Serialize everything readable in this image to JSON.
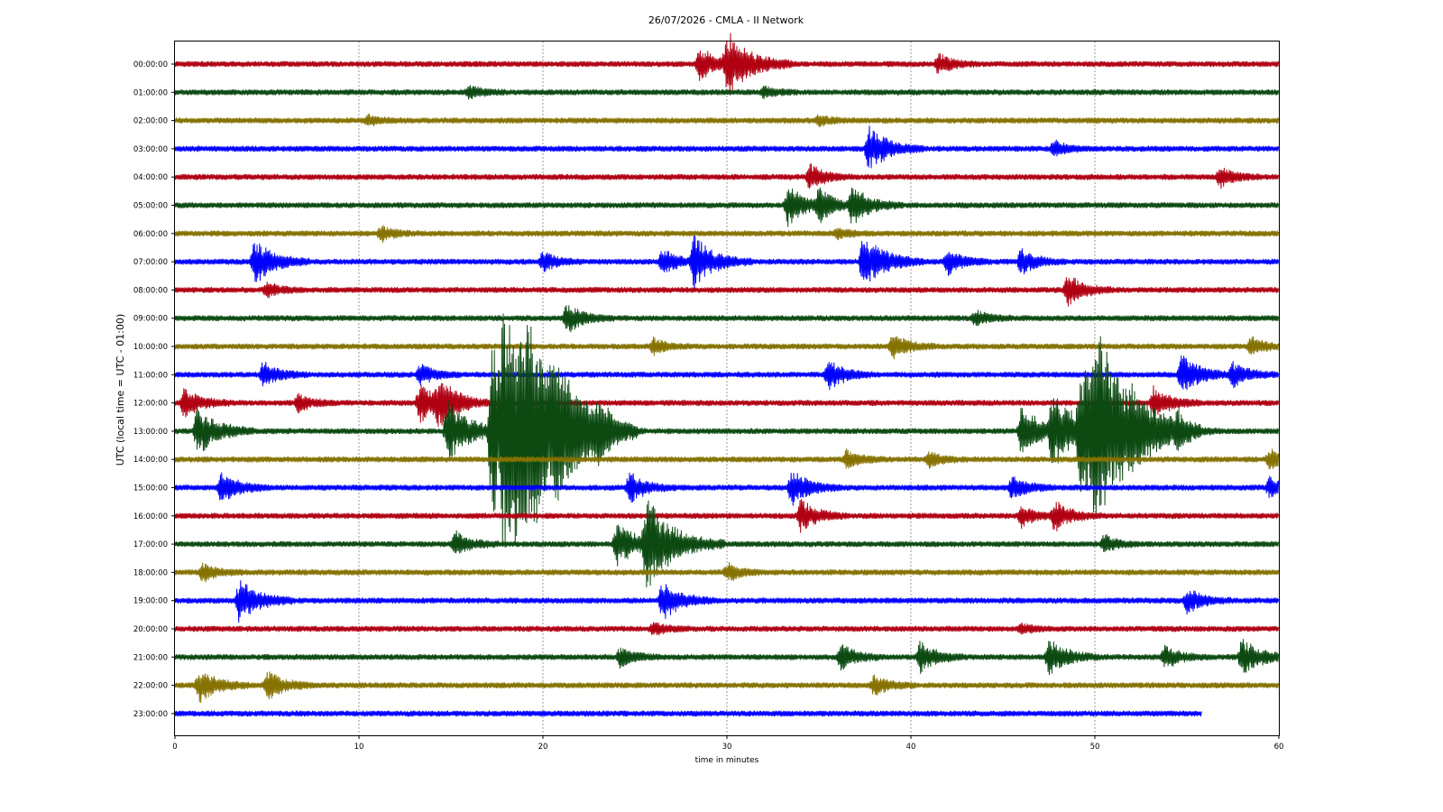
{
  "chart_data": {
    "type": "line",
    "title": "26/07/2026 - CMLA - II Network",
    "xlabel": "time in minutes",
    "ylabel": "UTC (local time = UTC - 01:00)",
    "xlim": [
      0,
      60
    ],
    "xticks": [
      "0",
      "10",
      "20",
      "30",
      "40",
      "50",
      "60"
    ],
    "grid": "vertical dashed lines at each 10 minutes",
    "trace_colors": [
      "#b00012",
      "#0c4a12",
      "#857200",
      "#0000ff"
    ],
    "rows": [
      {
        "label": "00:00:00",
        "end_min": 60,
        "events": [
          {
            "t": 28.5,
            "amp": 1.4
          },
          {
            "t": 30.0,
            "amp": 2.6
          },
          {
            "t": 41.5,
            "amp": 0.8
          }
        ]
      },
      {
        "label": "01:00:00",
        "end_min": 60,
        "events": [
          {
            "t": 16.0,
            "amp": 0.5
          },
          {
            "t": 32.0,
            "amp": 0.4
          }
        ]
      },
      {
        "label": "02:00:00",
        "end_min": 60,
        "events": [
          {
            "t": 10.5,
            "amp": 0.4
          },
          {
            "t": 35.0,
            "amp": 0.4
          }
        ]
      },
      {
        "label": "03:00:00",
        "end_min": 60,
        "events": [
          {
            "t": 37.7,
            "amp": 1.8
          },
          {
            "t": 47.8,
            "amp": 0.6
          }
        ]
      },
      {
        "label": "04:00:00",
        "end_min": 60,
        "events": [
          {
            "t": 34.5,
            "amp": 1.0
          },
          {
            "t": 56.8,
            "amp": 0.8
          }
        ]
      },
      {
        "label": "05:00:00",
        "end_min": 60,
        "events": [
          {
            "t": 33.3,
            "amp": 1.6
          },
          {
            "t": 35.0,
            "amp": 1.2
          },
          {
            "t": 36.8,
            "amp": 1.5
          }
        ]
      },
      {
        "label": "06:00:00",
        "end_min": 60,
        "events": [
          {
            "t": 11.2,
            "amp": 0.6
          },
          {
            "t": 36.0,
            "amp": 0.4
          }
        ]
      },
      {
        "label": "07:00:00",
        "end_min": 60,
        "events": [
          {
            "t": 4.3,
            "amp": 1.8
          },
          {
            "t": 20.0,
            "amp": 0.8
          },
          {
            "t": 26.5,
            "amp": 1.0
          },
          {
            "t": 28.2,
            "amp": 2.0
          },
          {
            "t": 37.4,
            "amp": 2.2
          },
          {
            "t": 42.0,
            "amp": 1.0
          },
          {
            "t": 46.0,
            "amp": 1.0
          }
        ]
      },
      {
        "label": "08:00:00",
        "end_min": 60,
        "events": [
          {
            "t": 5.0,
            "amp": 0.6
          },
          {
            "t": 48.5,
            "amp": 1.2
          }
        ]
      },
      {
        "label": "09:00:00",
        "end_min": 60,
        "events": [
          {
            "t": 21.3,
            "amp": 1.2
          },
          {
            "t": 43.5,
            "amp": 0.6
          }
        ]
      },
      {
        "label": "10:00:00",
        "end_min": 60,
        "events": [
          {
            "t": 26.0,
            "amp": 0.6
          },
          {
            "t": 39.0,
            "amp": 1.0
          },
          {
            "t": 58.5,
            "amp": 0.7
          }
        ]
      },
      {
        "label": "11:00:00",
        "end_min": 60,
        "events": [
          {
            "t": 4.8,
            "amp": 1.0
          },
          {
            "t": 13.3,
            "amp": 0.8
          },
          {
            "t": 35.5,
            "amp": 1.2
          },
          {
            "t": 54.7,
            "amp": 1.6
          },
          {
            "t": 57.5,
            "amp": 1.0
          }
        ]
      },
      {
        "label": "12:00:00",
        "end_min": 60,
        "events": [
          {
            "t": 0.5,
            "amp": 1.2
          },
          {
            "t": 6.7,
            "amp": 0.7
          },
          {
            "t": 13.3,
            "amp": 1.6
          },
          {
            "t": 14.3,
            "amp": 1.8
          },
          {
            "t": 53.2,
            "amp": 1.3
          }
        ]
      },
      {
        "label": "13:00:00",
        "end_min": 60,
        "events": [
          {
            "t": 1.2,
            "amp": 2.0
          },
          {
            "t": 14.8,
            "amp": 2.5
          },
          {
            "t": 17.2,
            "amp": 6.5
          },
          {
            "t": 17.9,
            "amp": 7.5
          },
          {
            "t": 19.0,
            "amp": 3.5
          },
          {
            "t": 20.6,
            "amp": 2.5
          },
          {
            "t": 23.0,
            "amp": 1.2
          },
          {
            "t": 46.0,
            "amp": 2.0
          },
          {
            "t": 47.7,
            "amp": 3.0
          },
          {
            "t": 49.2,
            "amp": 5.0
          },
          {
            "t": 50.0,
            "amp": 5.5
          },
          {
            "t": 52.0,
            "amp": 1.3
          },
          {
            "t": 54.5,
            "amp": 1.0
          }
        ]
      },
      {
        "label": "14:00:00",
        "end_min": 60,
        "events": [
          {
            "t": 36.5,
            "amp": 0.7
          },
          {
            "t": 41.0,
            "amp": 0.6
          },
          {
            "t": 59.5,
            "amp": 0.8
          }
        ]
      },
      {
        "label": "15:00:00",
        "end_min": 60,
        "events": [
          {
            "t": 2.5,
            "amp": 1.3
          },
          {
            "t": 24.7,
            "amp": 1.2
          },
          {
            "t": 33.5,
            "amp": 1.4
          },
          {
            "t": 45.5,
            "amp": 1.0
          },
          {
            "t": 59.5,
            "amp": 0.8
          }
        ]
      },
      {
        "label": "16:00:00",
        "end_min": 60,
        "events": [
          {
            "t": 34.0,
            "amp": 1.3
          },
          {
            "t": 46.0,
            "amp": 0.8
          },
          {
            "t": 47.8,
            "amp": 1.2
          }
        ]
      },
      {
        "label": "17:00:00",
        "end_min": 60,
        "events": [
          {
            "t": 15.2,
            "amp": 1.0
          },
          {
            "t": 24.0,
            "amp": 1.8
          },
          {
            "t": 25.6,
            "amp": 3.5
          },
          {
            "t": 50.5,
            "amp": 0.7
          }
        ]
      },
      {
        "label": "18:00:00",
        "end_min": 60,
        "events": [
          {
            "t": 1.5,
            "amp": 0.7
          },
          {
            "t": 30.0,
            "amp": 0.7
          }
        ]
      },
      {
        "label": "19:00:00",
        "end_min": 60,
        "events": [
          {
            "t": 3.5,
            "amp": 1.8
          },
          {
            "t": 26.5,
            "amp": 1.6
          },
          {
            "t": 55.0,
            "amp": 1.0
          }
        ]
      },
      {
        "label": "20:00:00",
        "end_min": 60,
        "events": [
          {
            "t": 26.0,
            "amp": 0.5
          },
          {
            "t": 46.0,
            "amp": 0.4
          }
        ]
      },
      {
        "label": "21:00:00",
        "end_min": 60,
        "events": [
          {
            "t": 24.2,
            "amp": 0.8
          },
          {
            "t": 36.2,
            "amp": 1.0
          },
          {
            "t": 40.5,
            "amp": 1.2
          },
          {
            "t": 47.5,
            "amp": 1.5
          },
          {
            "t": 53.8,
            "amp": 0.9
          },
          {
            "t": 58.0,
            "amp": 1.5
          }
        ]
      },
      {
        "label": "22:00:00",
        "end_min": 60,
        "events": [
          {
            "t": 1.3,
            "amp": 1.4
          },
          {
            "t": 5.0,
            "amp": 1.2
          },
          {
            "t": 38.0,
            "amp": 0.8
          }
        ]
      },
      {
        "label": "23:00:00",
        "end_min": 55.8,
        "events": []
      }
    ]
  }
}
